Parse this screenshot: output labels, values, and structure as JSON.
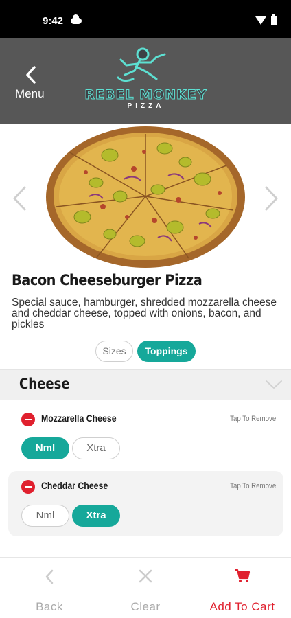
{
  "status_bar": {
    "time": "9:42"
  },
  "header": {
    "menu_label": "Menu",
    "logo_text": "REBEL MONKEY",
    "logo_sub": "PIZZA"
  },
  "product": {
    "title": "Bacon Cheeseburger Pizza",
    "description": "Special sauce, hamburger, shredded mozzarella cheese and cheddar cheese, topped with onions, bacon, and pickles"
  },
  "segments": {
    "sizes": "Sizes",
    "toppings": "Toppings",
    "selected": "Toppings"
  },
  "section": {
    "title": "Cheese"
  },
  "toppings": [
    {
      "name": "Mozzarella Cheese",
      "action": "Tap To Remove",
      "options": [
        "Nml",
        "Xtra"
      ],
      "selected": "Nml"
    },
    {
      "name": "Cheddar Cheese",
      "action": "Tap To Remove",
      "options": [
        "Nml",
        "Xtra"
      ],
      "selected": "Xtra"
    }
  ],
  "bottom_bar": {
    "back": "Back",
    "clear": "Clear",
    "add_to_cart": "Add To Cart"
  },
  "colors": {
    "accent": "#16a89a",
    "danger": "#e0202e",
    "header_bg": "#575757"
  }
}
